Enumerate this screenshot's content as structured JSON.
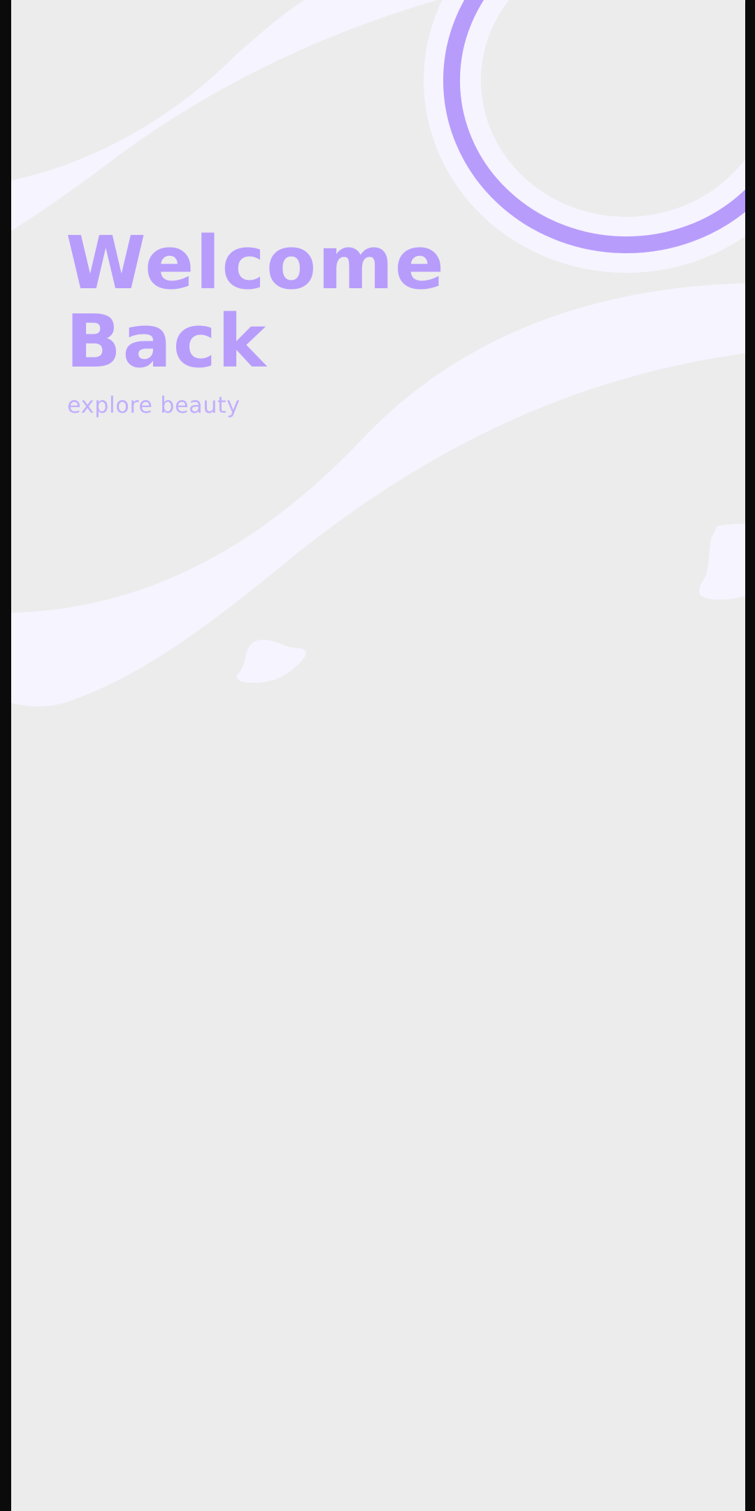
{
  "colors": {
    "background": "#ececec",
    "accent": "#b79cfc",
    "wave": "#f6f4ff",
    "frame": "#0b0b0b"
  },
  "header": {
    "title_line1": "Welcome",
    "title_line2": "Back",
    "subtitle": "explore beauty"
  }
}
